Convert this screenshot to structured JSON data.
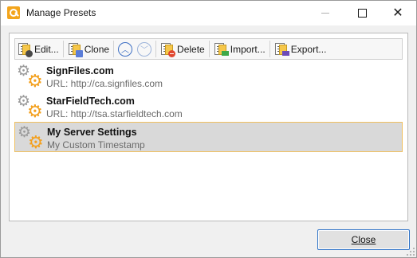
{
  "window": {
    "title": "Manage Presets",
    "close_label": "Close"
  },
  "toolbar": {
    "edit_label": "Edit...",
    "clone_label": "Clone",
    "delete_label": "Delete",
    "import_label": "Import...",
    "export_label": "Export..."
  },
  "presets": [
    {
      "name": "SignFiles.com",
      "detail": "URL: http://ca.signfiles.com",
      "selected": false
    },
    {
      "name": "StarFieldTech.com",
      "detail": "URL: http://tsa.starfieldtech.com",
      "selected": false
    },
    {
      "name": "My Server Settings",
      "detail": "My Custom Timestamp",
      "selected": true
    }
  ],
  "colors": {
    "accent": "#2f73c7",
    "selection_border": "#f0c060",
    "gear_orange": "#f3a01e"
  }
}
